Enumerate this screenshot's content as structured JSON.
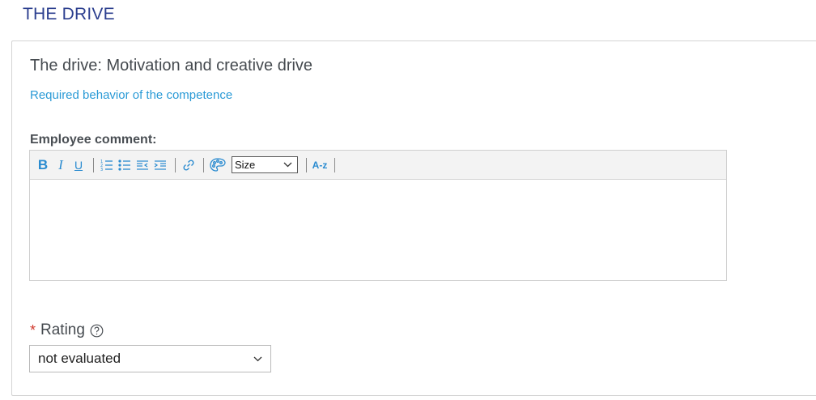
{
  "section": {
    "title": "THE DRIVE"
  },
  "competency": {
    "title": "The drive: Motivation and creative drive",
    "behavior_link": "Required behavior of the competence"
  },
  "comment": {
    "label": "Employee comment:",
    "toolbar": {
      "bold": "B",
      "italic": "I",
      "underline": "U",
      "size_label": "Size",
      "az_label": "A-z",
      "icons": [
        "numbered-list-icon",
        "bulleted-list-icon",
        "outdent-icon",
        "indent-icon",
        "link-icon",
        "palette-icon",
        "chevron-down-icon"
      ]
    },
    "value": ""
  },
  "rating": {
    "label": "Rating",
    "required_marker": "*",
    "selected": "not evaluated"
  },
  "colors": {
    "section_title": "#2c3f8f",
    "link": "#2a9ad6",
    "toolbar_icon": "#2a8bd0",
    "required": "#d0382c"
  }
}
